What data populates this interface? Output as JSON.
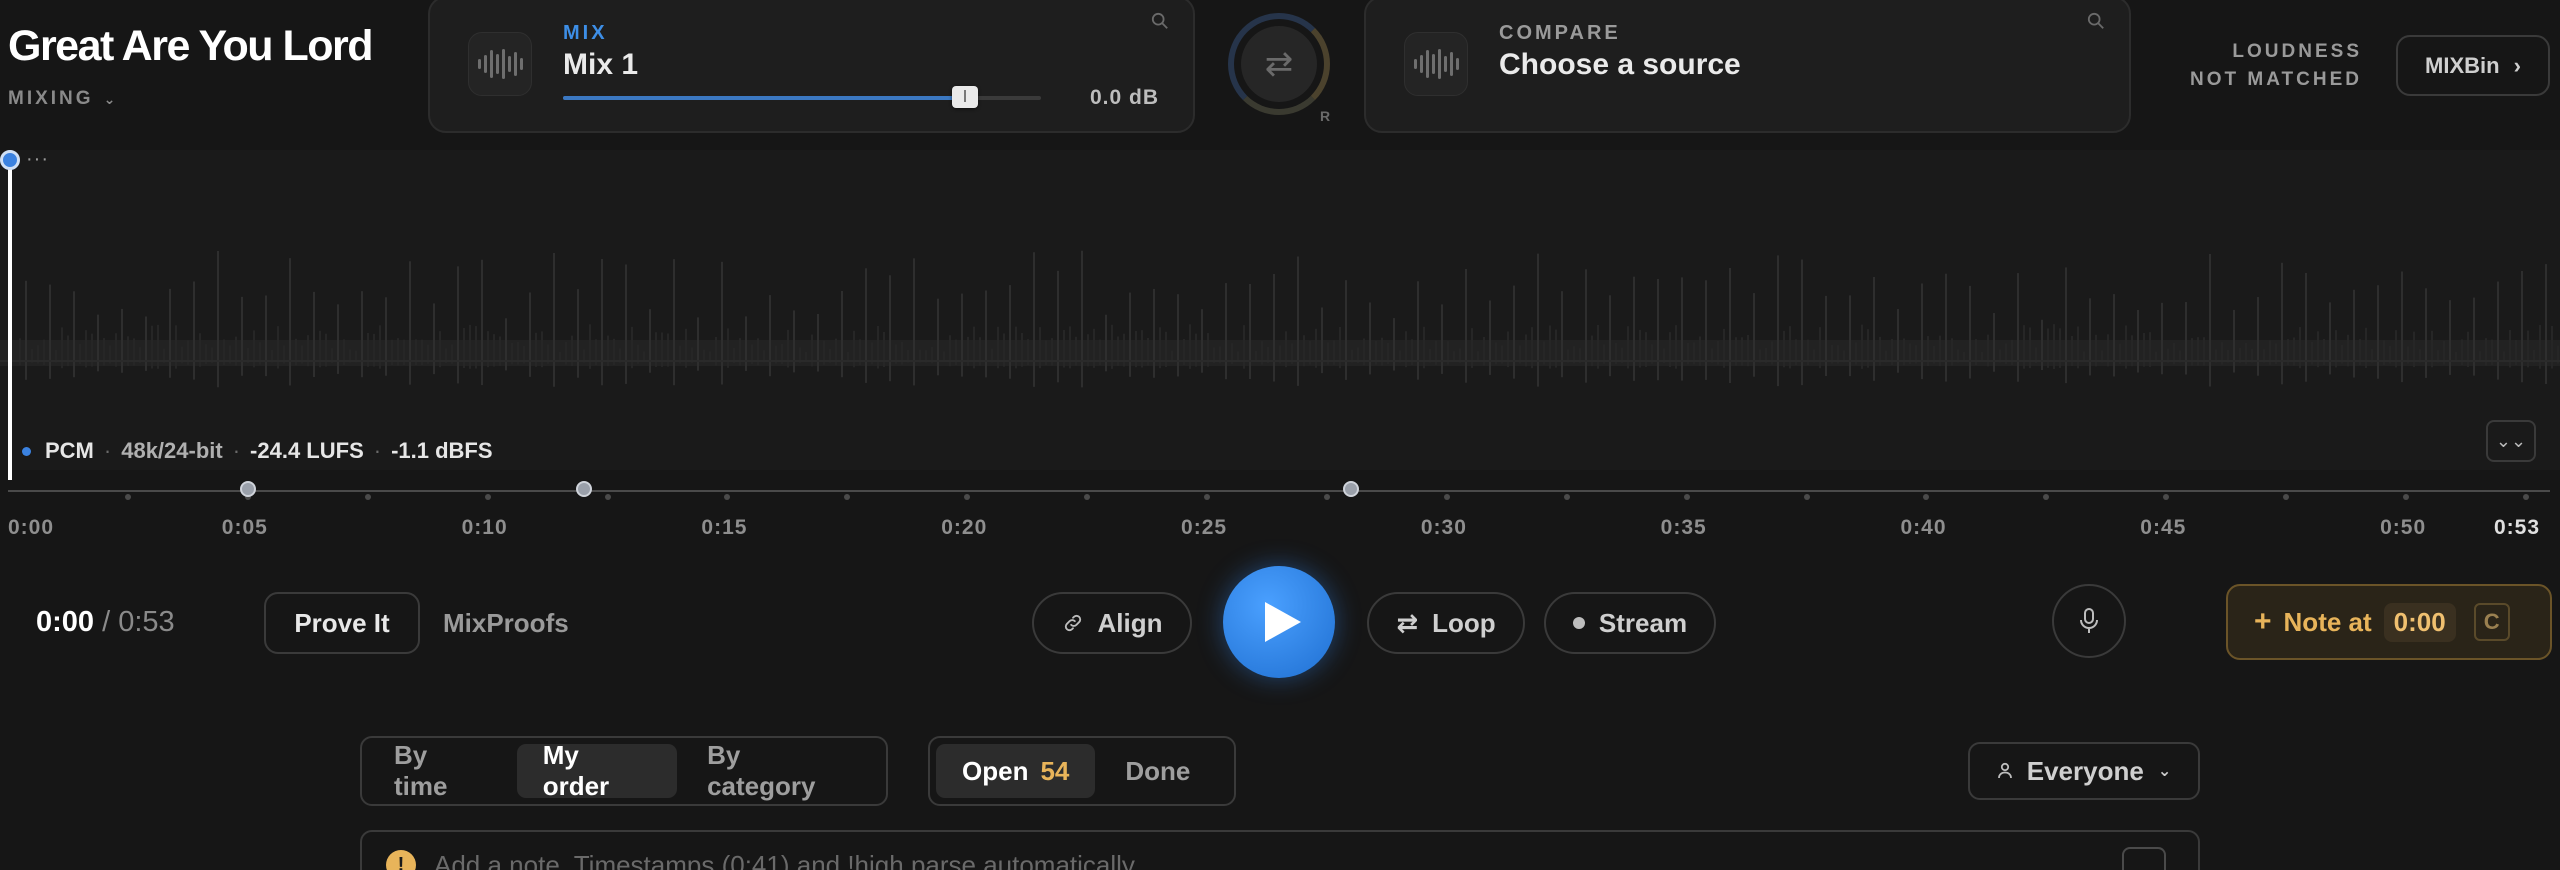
{
  "song": {
    "title": "Great Are You Lord",
    "stage": "MIXING"
  },
  "mix_card": {
    "kicker": "MIX",
    "name": "Mix 1",
    "gain": "0.0 dB",
    "fader_level": 0.84
  },
  "compare_card": {
    "kicker": "COMPARE",
    "name": "Choose a source"
  },
  "swap": {
    "side_label": "R"
  },
  "loudness": {
    "line1": "LOUDNESS",
    "line2": "NOT MATCHED"
  },
  "mixbin": {
    "label": "MIXBin"
  },
  "format": {
    "codec": "PCM",
    "rate": "48k/24-bit",
    "lufs": "-24.4 LUFS",
    "peak": "-1.1 dBFS"
  },
  "timeline": {
    "ticks": [
      "0:00",
      "0:05",
      "0:10",
      "0:15",
      "0:20",
      "0:25",
      "0:30",
      "0:35",
      "0:40",
      "0:45",
      "0:50"
    ],
    "end_label": "0:53",
    "duration_seconds": 53,
    "marker_times": [
      5,
      12,
      28
    ]
  },
  "transport": {
    "current": "0:00",
    "duration": "0:53",
    "prove_label": "Prove It",
    "proofs_label": "MixProofs",
    "align_label": "Align",
    "loop_label": "Loop",
    "stream_label": "Stream",
    "note_label": "Note at",
    "note_time": "0:00",
    "note_key": "C"
  },
  "filters": {
    "sort_options": [
      "By time",
      "My order",
      "By category"
    ],
    "sort_selected": "My order",
    "status_open_label": "Open",
    "status_open_count": "54",
    "status_done_label": "Done",
    "audience": "Everyone"
  },
  "note_input": {
    "placeholder": "Add a note. Timestamps (0:41) and !high parse automatically."
  },
  "colors": {
    "accent": "#3b82e0",
    "note": "#e8b45a",
    "background": "#161616"
  }
}
